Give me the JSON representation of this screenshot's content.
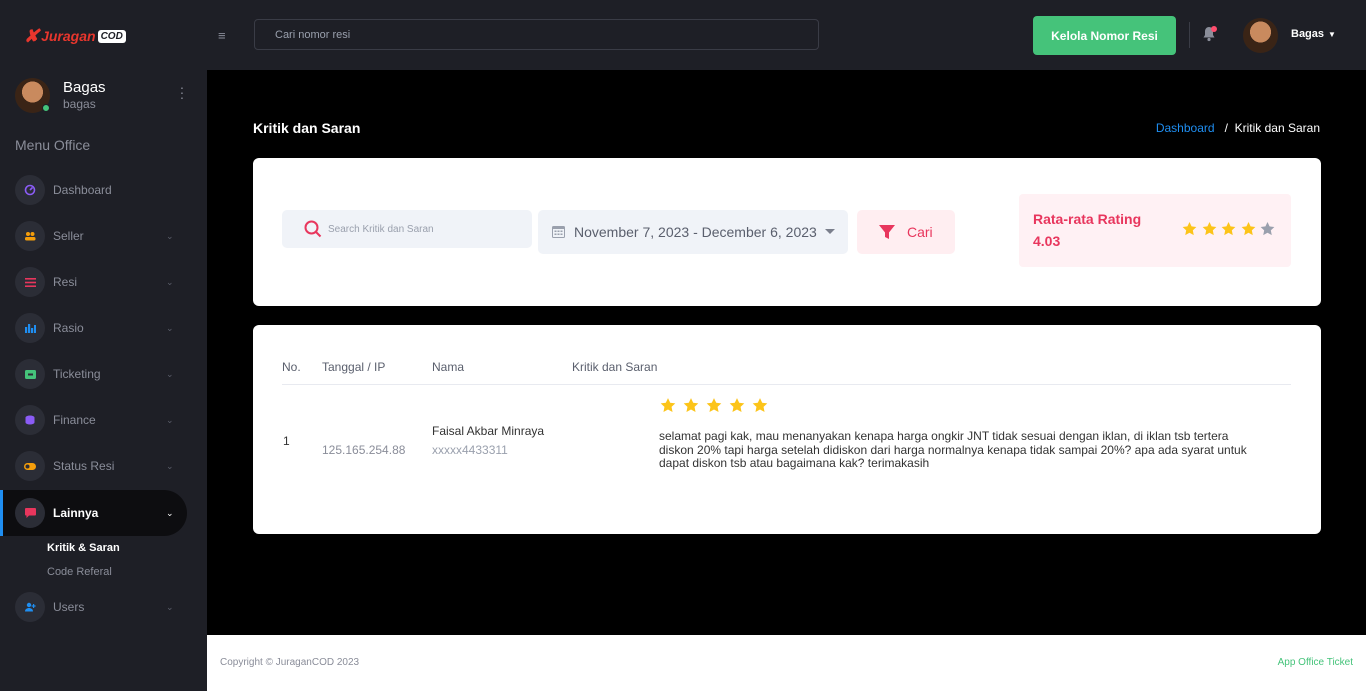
{
  "brand": {
    "name": "Juragan",
    "suffix": "COD"
  },
  "topbar": {
    "search_placeholder": "Cari nomor resi",
    "kelola_label": "Kelola Nomor Resi",
    "user_name": "Bagas"
  },
  "sidebar": {
    "user_name": "Bagas",
    "user_handle": "bagas",
    "section": "Menu Office",
    "items": [
      {
        "label": "Dashboard",
        "icon": "gauge-icon",
        "color": "#8b5cf6"
      },
      {
        "label": "Seller",
        "icon": "users-icon",
        "color": "#f59e0b"
      },
      {
        "label": "Resi",
        "icon": "list-icon",
        "color": "#e8365d"
      },
      {
        "label": "Rasio",
        "icon": "chart-icon",
        "color": "#1f8ef1"
      },
      {
        "label": "Ticketing",
        "icon": "ticket-icon",
        "color": "#45c37a"
      },
      {
        "label": "Finance",
        "icon": "coins-icon",
        "color": "#8b5cf6"
      },
      {
        "label": "Status Resi",
        "icon": "toggle-icon",
        "color": "#f59e0b"
      },
      {
        "label": "Lainnya",
        "icon": "message-icon",
        "color": "#e8365d"
      },
      {
        "label": "Users",
        "icon": "user-add-icon",
        "color": "#1f8ef1"
      }
    ],
    "subitems": [
      "Kritik & Saran",
      "Code Referal"
    ]
  },
  "page": {
    "title": "Kritik dan Saran",
    "breadcrumb": {
      "home": "Dashboard",
      "sep": "/",
      "current": "Kritik dan Saran"
    }
  },
  "filters": {
    "search_placeholder": "Search Kritik dan Saran",
    "date_range": "November 7, 2023 - December 6, 2023",
    "cari_label": "Cari"
  },
  "rating": {
    "title": "Rata-rata Rating",
    "value": "4.03",
    "stars_filled": 4,
    "stars_total": 5
  },
  "table": {
    "headers": [
      "No.",
      "Tanggal / IP",
      "Nama",
      "Kritik dan Saran"
    ],
    "rows": [
      {
        "no": "1",
        "ip": "125.165.254.88",
        "name": "Faisal Akbar Minraya",
        "phone": "xxxxx4433311",
        "stars": 5,
        "text": "selamat pagi kak, mau menanyakan kenapa harga ongkir JNT tidak sesuai dengan iklan, di iklan tsb tertera diskon 20% tapi harga setelah didiskon dari harga normalnya kenapa tidak sampai 20%? apa ada syarat untuk dapat diskon tsb atau bagaimana kak? terimakasih"
      }
    ]
  },
  "footer": {
    "copyright": "Copyright © JuraganCOD 2023",
    "app": "App Office Ticket"
  },
  "colors": {
    "accent_green": "#45c37a",
    "accent_pink": "#e8365d",
    "accent_blue": "#1f8ef1",
    "star": "#fcc419",
    "star_empty": "#9aa0ad"
  }
}
